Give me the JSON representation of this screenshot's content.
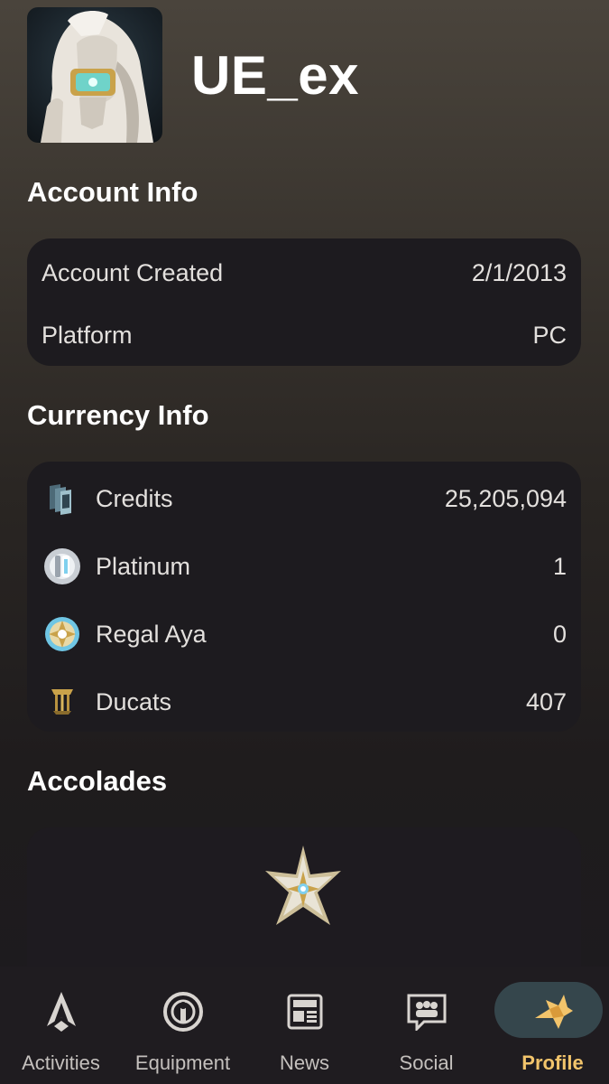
{
  "profile": {
    "username": "UE_ex"
  },
  "account_info": {
    "title": "Account Info",
    "rows": [
      {
        "label": "Account Created",
        "value": "2/1/2013"
      },
      {
        "label": "Platform",
        "value": "PC"
      }
    ]
  },
  "currency_info": {
    "title": "Currency Info",
    "rows": [
      {
        "icon": "credits-icon",
        "label": "Credits",
        "value": "25,205,094"
      },
      {
        "icon": "platinum-icon",
        "label": "Platinum",
        "value": "1"
      },
      {
        "icon": "regal-aya-icon",
        "label": "Regal Aya",
        "value": "0"
      },
      {
        "icon": "ducats-icon",
        "label": "Ducats",
        "value": "407"
      }
    ]
  },
  "accolades": {
    "title": "Accolades",
    "badge_icon": "accolade-star-icon"
  },
  "nav": {
    "items": [
      {
        "label": "Activities",
        "icon": "activities-icon"
      },
      {
        "label": "Equipment",
        "icon": "equipment-icon"
      },
      {
        "label": "News",
        "icon": "news-icon"
      },
      {
        "label": "Social",
        "icon": "social-icon"
      },
      {
        "label": "Profile",
        "icon": "profile-icon",
        "active": true
      }
    ]
  },
  "colors": {
    "accent": "#f2c46b",
    "card_bg": "#1d1b1f",
    "active_pill": "#35464c"
  }
}
